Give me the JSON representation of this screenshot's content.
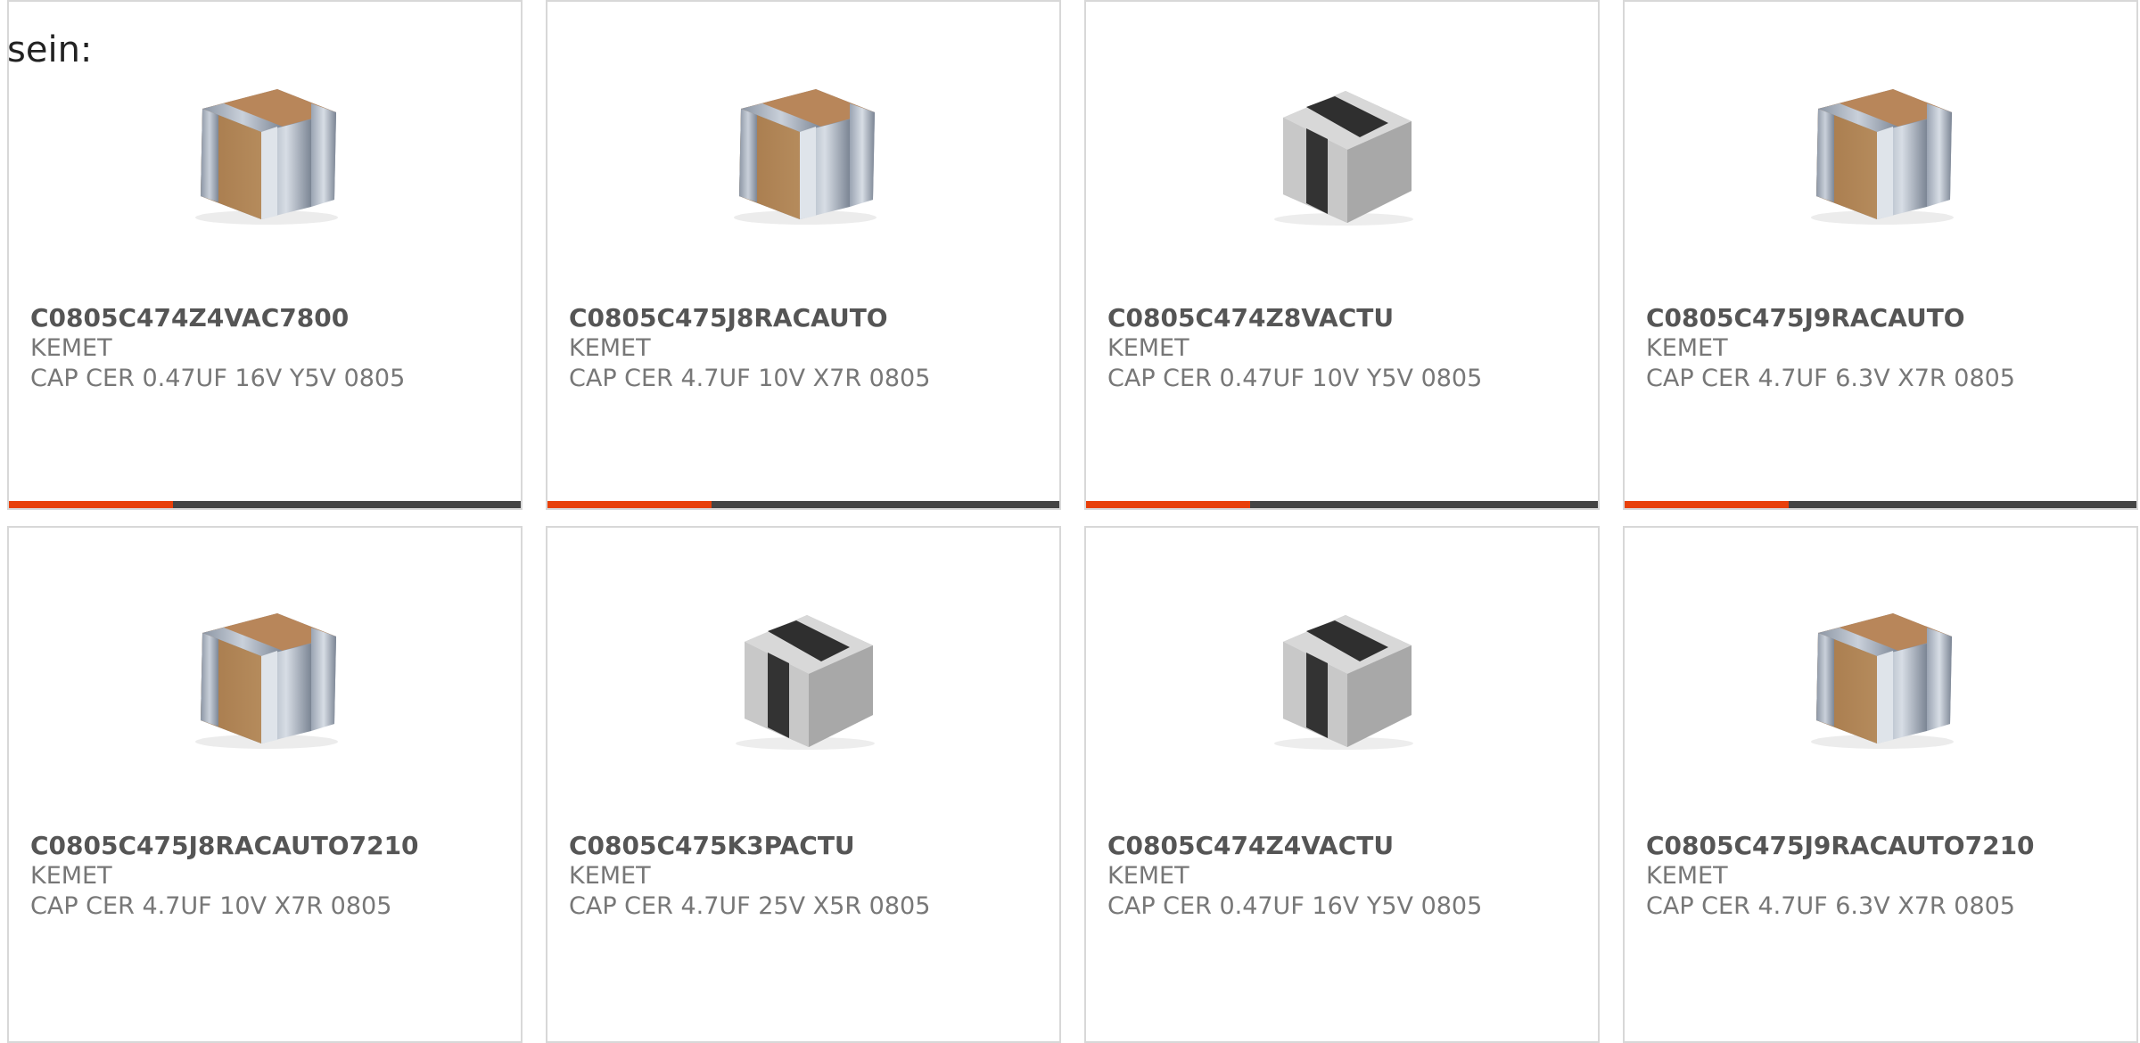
{
  "intro_text": "sein:",
  "colors": {
    "accent": "#e8400a",
    "track": "#444444",
    "border": "#d8d8d8"
  },
  "products": [
    {
      "part_number": "C0805C474Z4VAC7800",
      "manufacturer": "KEMET",
      "description": "CAP CER 0.47UF 16V Y5V 0805",
      "image": "tan-capacitor-chip",
      "progress": 0.32
    },
    {
      "part_number": "C0805C475J8RACAUTO",
      "manufacturer": "KEMET",
      "description": "CAP CER 4.7UF 10V X7R 0805",
      "image": "tan-capacitor-chip",
      "progress": 0.32
    },
    {
      "part_number": "C0805C474Z8VACTU",
      "manufacturer": "KEMET",
      "description": "CAP CER 0.47UF 10V Y5V 0805",
      "image": "dark-capacitor-chip",
      "progress": 0.32
    },
    {
      "part_number": "C0805C475J9RACAUTO",
      "manufacturer": "KEMET",
      "description": "CAP CER 4.7UF 6.3V X7R 0805",
      "image": "tan-capacitor-chip",
      "progress": 0.32
    },
    {
      "part_number": "C0805C475J8RACAUTO7210",
      "manufacturer": "KEMET",
      "description": "CAP CER 4.7UF 10V X7R 0805",
      "image": "tan-capacitor-chip"
    },
    {
      "part_number": "C0805C475K3PACTU",
      "manufacturer": "KEMET",
      "description": "CAP CER 4.7UF 25V X5R 0805",
      "image": "dark-capacitor-chip"
    },
    {
      "part_number": "C0805C474Z4VACTU",
      "manufacturer": "KEMET",
      "description": "CAP CER 0.47UF 16V Y5V 0805",
      "image": "dark-capacitor-chip"
    },
    {
      "part_number": "C0805C475J9RACAUTO7210",
      "manufacturer": "KEMET",
      "description": "CAP CER 4.7UF 6.3V X7R 0805",
      "image": "tan-capacitor-chip"
    }
  ]
}
